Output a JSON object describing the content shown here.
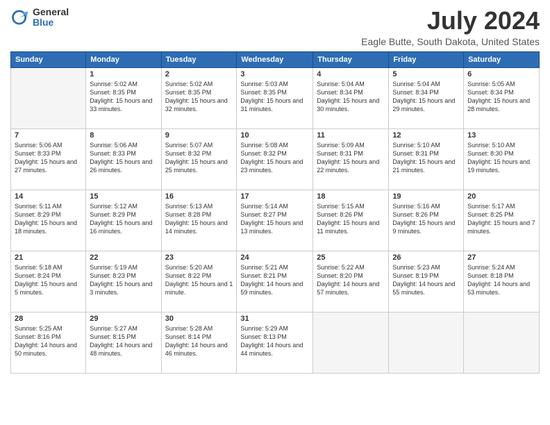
{
  "logo": {
    "general": "General",
    "blue": "Blue"
  },
  "header": {
    "month": "July 2024",
    "location": "Eagle Butte, South Dakota, United States"
  },
  "weekdays": [
    "Sunday",
    "Monday",
    "Tuesday",
    "Wednesday",
    "Thursday",
    "Friday",
    "Saturday"
  ],
  "weeks": [
    [
      {
        "day": "",
        "sunrise": "",
        "sunset": "",
        "daylight": ""
      },
      {
        "day": "1",
        "sunrise": "Sunrise: 5:02 AM",
        "sunset": "Sunset: 8:35 PM",
        "daylight": "Daylight: 15 hours and 33 minutes."
      },
      {
        "day": "2",
        "sunrise": "Sunrise: 5:02 AM",
        "sunset": "Sunset: 8:35 PM",
        "daylight": "Daylight: 15 hours and 32 minutes."
      },
      {
        "day": "3",
        "sunrise": "Sunrise: 5:03 AM",
        "sunset": "Sunset: 8:35 PM",
        "daylight": "Daylight: 15 hours and 31 minutes."
      },
      {
        "day": "4",
        "sunrise": "Sunrise: 5:04 AM",
        "sunset": "Sunset: 8:34 PM",
        "daylight": "Daylight: 15 hours and 30 minutes."
      },
      {
        "day": "5",
        "sunrise": "Sunrise: 5:04 AM",
        "sunset": "Sunset: 8:34 PM",
        "daylight": "Daylight: 15 hours and 29 minutes."
      },
      {
        "day": "6",
        "sunrise": "Sunrise: 5:05 AM",
        "sunset": "Sunset: 8:34 PM",
        "daylight": "Daylight: 15 hours and 28 minutes."
      }
    ],
    [
      {
        "day": "7",
        "sunrise": "Sunrise: 5:06 AM",
        "sunset": "Sunset: 8:33 PM",
        "daylight": "Daylight: 15 hours and 27 minutes."
      },
      {
        "day": "8",
        "sunrise": "Sunrise: 5:06 AM",
        "sunset": "Sunset: 8:33 PM",
        "daylight": "Daylight: 15 hours and 26 minutes."
      },
      {
        "day": "9",
        "sunrise": "Sunrise: 5:07 AM",
        "sunset": "Sunset: 8:32 PM",
        "daylight": "Daylight: 15 hours and 25 minutes."
      },
      {
        "day": "10",
        "sunrise": "Sunrise: 5:08 AM",
        "sunset": "Sunset: 8:32 PM",
        "daylight": "Daylight: 15 hours and 23 minutes."
      },
      {
        "day": "11",
        "sunrise": "Sunrise: 5:09 AM",
        "sunset": "Sunset: 8:31 PM",
        "daylight": "Daylight: 15 hours and 22 minutes."
      },
      {
        "day": "12",
        "sunrise": "Sunrise: 5:10 AM",
        "sunset": "Sunset: 8:31 PM",
        "daylight": "Daylight: 15 hours and 21 minutes."
      },
      {
        "day": "13",
        "sunrise": "Sunrise: 5:10 AM",
        "sunset": "Sunset: 8:30 PM",
        "daylight": "Daylight: 15 hours and 19 minutes."
      }
    ],
    [
      {
        "day": "14",
        "sunrise": "Sunrise: 5:11 AM",
        "sunset": "Sunset: 8:29 PM",
        "daylight": "Daylight: 15 hours and 18 minutes."
      },
      {
        "day": "15",
        "sunrise": "Sunrise: 5:12 AM",
        "sunset": "Sunset: 8:29 PM",
        "daylight": "Daylight: 15 hours and 16 minutes."
      },
      {
        "day": "16",
        "sunrise": "Sunrise: 5:13 AM",
        "sunset": "Sunset: 8:28 PM",
        "daylight": "Daylight: 15 hours and 14 minutes."
      },
      {
        "day": "17",
        "sunrise": "Sunrise: 5:14 AM",
        "sunset": "Sunset: 8:27 PM",
        "daylight": "Daylight: 15 hours and 13 minutes."
      },
      {
        "day": "18",
        "sunrise": "Sunrise: 5:15 AM",
        "sunset": "Sunset: 8:26 PM",
        "daylight": "Daylight: 15 hours and 11 minutes."
      },
      {
        "day": "19",
        "sunrise": "Sunrise: 5:16 AM",
        "sunset": "Sunset: 8:26 PM",
        "daylight": "Daylight: 15 hours and 9 minutes."
      },
      {
        "day": "20",
        "sunrise": "Sunrise: 5:17 AM",
        "sunset": "Sunset: 8:25 PM",
        "daylight": "Daylight: 15 hours and 7 minutes."
      }
    ],
    [
      {
        "day": "21",
        "sunrise": "Sunrise: 5:18 AM",
        "sunset": "Sunset: 8:24 PM",
        "daylight": "Daylight: 15 hours and 5 minutes."
      },
      {
        "day": "22",
        "sunrise": "Sunrise: 5:19 AM",
        "sunset": "Sunset: 8:23 PM",
        "daylight": "Daylight: 15 hours and 3 minutes."
      },
      {
        "day": "23",
        "sunrise": "Sunrise: 5:20 AM",
        "sunset": "Sunset: 8:22 PM",
        "daylight": "Daylight: 15 hours and 1 minute."
      },
      {
        "day": "24",
        "sunrise": "Sunrise: 5:21 AM",
        "sunset": "Sunset: 8:21 PM",
        "daylight": "Daylight: 14 hours and 59 minutes."
      },
      {
        "day": "25",
        "sunrise": "Sunrise: 5:22 AM",
        "sunset": "Sunset: 8:20 PM",
        "daylight": "Daylight: 14 hours and 57 minutes."
      },
      {
        "day": "26",
        "sunrise": "Sunrise: 5:23 AM",
        "sunset": "Sunset: 8:19 PM",
        "daylight": "Daylight: 14 hours and 55 minutes."
      },
      {
        "day": "27",
        "sunrise": "Sunrise: 5:24 AM",
        "sunset": "Sunset: 8:18 PM",
        "daylight": "Daylight: 14 hours and 53 minutes."
      }
    ],
    [
      {
        "day": "28",
        "sunrise": "Sunrise: 5:25 AM",
        "sunset": "Sunset: 8:16 PM",
        "daylight": "Daylight: 14 hours and 50 minutes."
      },
      {
        "day": "29",
        "sunrise": "Sunrise: 5:27 AM",
        "sunset": "Sunset: 8:15 PM",
        "daylight": "Daylight: 14 hours and 48 minutes."
      },
      {
        "day": "30",
        "sunrise": "Sunrise: 5:28 AM",
        "sunset": "Sunset: 8:14 PM",
        "daylight": "Daylight: 14 hours and 46 minutes."
      },
      {
        "day": "31",
        "sunrise": "Sunrise: 5:29 AM",
        "sunset": "Sunset: 8:13 PM",
        "daylight": "Daylight: 14 hours and 44 minutes."
      },
      {
        "day": "",
        "sunrise": "",
        "sunset": "",
        "daylight": ""
      },
      {
        "day": "",
        "sunrise": "",
        "sunset": "",
        "daylight": ""
      },
      {
        "day": "",
        "sunrise": "",
        "sunset": "",
        "daylight": ""
      }
    ]
  ]
}
